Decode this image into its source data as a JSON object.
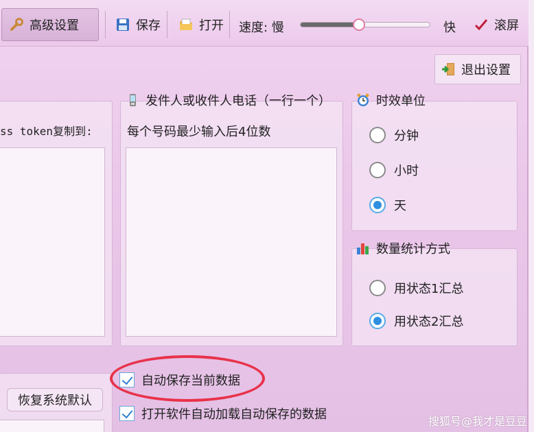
{
  "toolbar": {
    "advanced_label": "高级设置",
    "save_label": "保存",
    "open_label": "打开",
    "speed_label": "速度: 慢",
    "speed_fast_label": "快",
    "speed_value": 0.45,
    "scroll_label": "滚屏"
  },
  "exit_label": "退出设置",
  "left_panel": {
    "caption": "ss token复制到:"
  },
  "phone_panel": {
    "title": "发件人或收件人电话（一行一个）",
    "hint": "每个号码最少输入后4位数"
  },
  "time_unit": {
    "title": "时效单位",
    "options": [
      "分钟",
      "小时",
      "天"
    ],
    "selected": "天"
  },
  "stat_method": {
    "title": "数量统计方式",
    "options": [
      "用状态1汇总",
      "用状态2汇总"
    ],
    "selected": "用状态2汇总"
  },
  "restore_label": "恢复系统默认",
  "auto_save_label": "自动保存当前数据",
  "auto_load_label": "打开软件自动加载自动保存的数据",
  "watermark": "搜狐号@我才是豆豆",
  "colors": {
    "accent_blue": "#2f8fe0",
    "highlight_red": "#e8324a",
    "background": "#ebc8ea"
  }
}
